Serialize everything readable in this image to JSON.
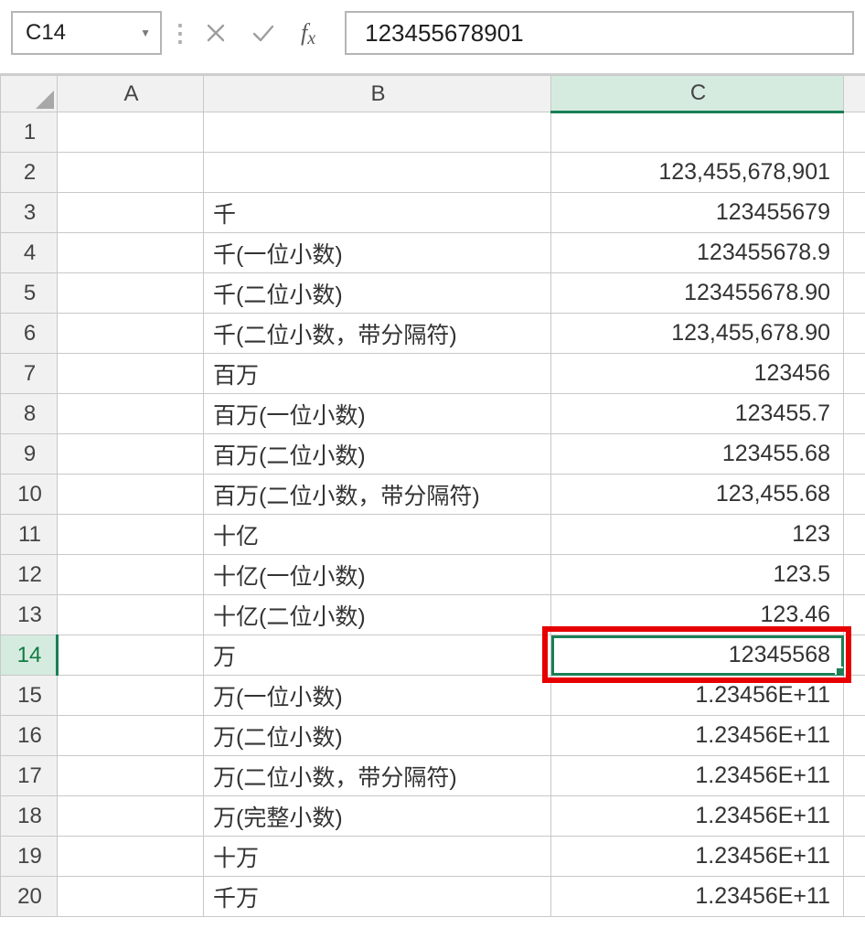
{
  "namebox": {
    "value": "C14"
  },
  "formula_input": "123455678901",
  "columns": [
    "A",
    "B",
    "C"
  ],
  "selected": {
    "cell_ref": "C14",
    "row": 14,
    "col": "C"
  },
  "rows": [
    {
      "n": 1,
      "b": "",
      "c": ""
    },
    {
      "n": 2,
      "b": "",
      "c": "123,455,678,901"
    },
    {
      "n": 3,
      "b": "千",
      "c": "123455679"
    },
    {
      "n": 4,
      "b": "千(一位小数)",
      "c": "123455678.9"
    },
    {
      "n": 5,
      "b": "千(二位小数)",
      "c": "123455678.90"
    },
    {
      "n": 6,
      "b": "千(二位小数，带分隔符)",
      "c": "123,455,678.90"
    },
    {
      "n": 7,
      "b": "百万",
      "c": "123456"
    },
    {
      "n": 8,
      "b": "百万(一位小数)",
      "c": "123455.7"
    },
    {
      "n": 9,
      "b": "百万(二位小数)",
      "c": "123455.68"
    },
    {
      "n": 10,
      "b": "百万(二位小数，带分隔符)",
      "c": "123,455.68"
    },
    {
      "n": 11,
      "b": "十亿",
      "c": "123"
    },
    {
      "n": 12,
      "b": "十亿(一位小数)",
      "c": "123.5"
    },
    {
      "n": 13,
      "b": "十亿(二位小数)",
      "c": "123.46"
    },
    {
      "n": 14,
      "b": "万",
      "c": "12345568"
    },
    {
      "n": 15,
      "b": "万(一位小数)",
      "c": "1.23456E+11"
    },
    {
      "n": 16,
      "b": "万(二位小数)",
      "c": "1.23456E+11"
    },
    {
      "n": 17,
      "b": "万(二位小数，带分隔符)",
      "c": "1.23456E+11"
    },
    {
      "n": 18,
      "b": "万(完整小数)",
      "c": "1.23456E+11"
    },
    {
      "n": 19,
      "b": "十万",
      "c": "1.23456E+11"
    },
    {
      "n": 20,
      "b": "千万",
      "c": "1.23456E+11"
    }
  ],
  "annotation": {
    "active_cell_highlight": true
  }
}
